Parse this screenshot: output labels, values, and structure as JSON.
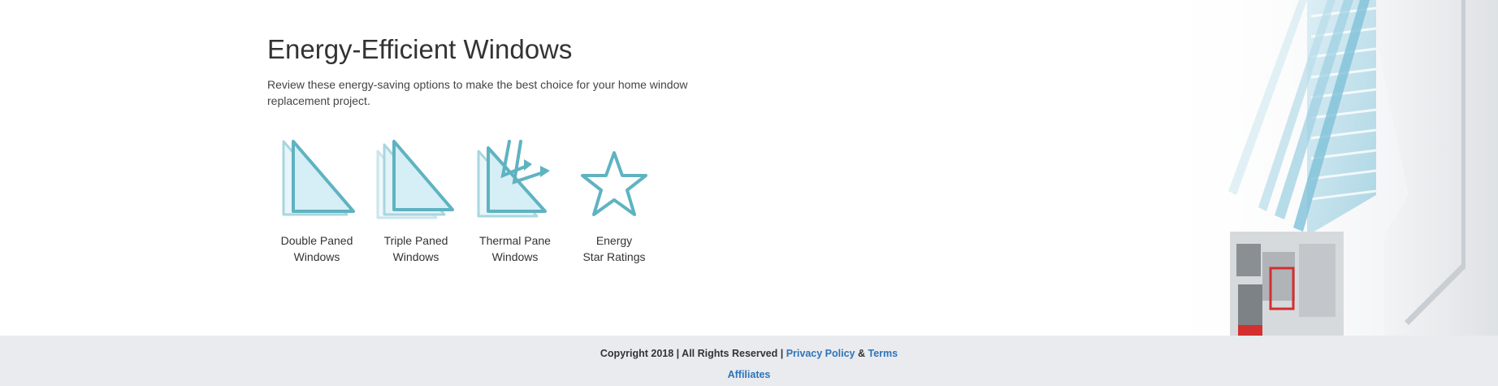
{
  "section": {
    "title": "Energy-Efficient Windows",
    "intro": "Review these energy-saving options to make the best choice for your home window replacement project."
  },
  "features": [
    {
      "icon": "double-pane-icon",
      "label": "Double Paned\nWindows"
    },
    {
      "icon": "triple-pane-icon",
      "label": "Triple Paned\nWindows"
    },
    {
      "icon": "thermal-pane-icon",
      "label": "Thermal Pane\nWindows"
    },
    {
      "icon": "star-icon",
      "label": "Energy\nStar Ratings"
    }
  ],
  "footer": {
    "copyright": "Copyright 2018 | All Rights Reserved |",
    "privacy_label": "Privacy Policy",
    "amp": "&",
    "terms_label": "Terms",
    "affiliates_label": "Affiliates"
  },
  "colors": {
    "icon_teal": "#6bb9c6",
    "icon_fill": "#dff1f7",
    "link_blue": "#2f73b7",
    "footer_bg": "#e9ebef"
  }
}
